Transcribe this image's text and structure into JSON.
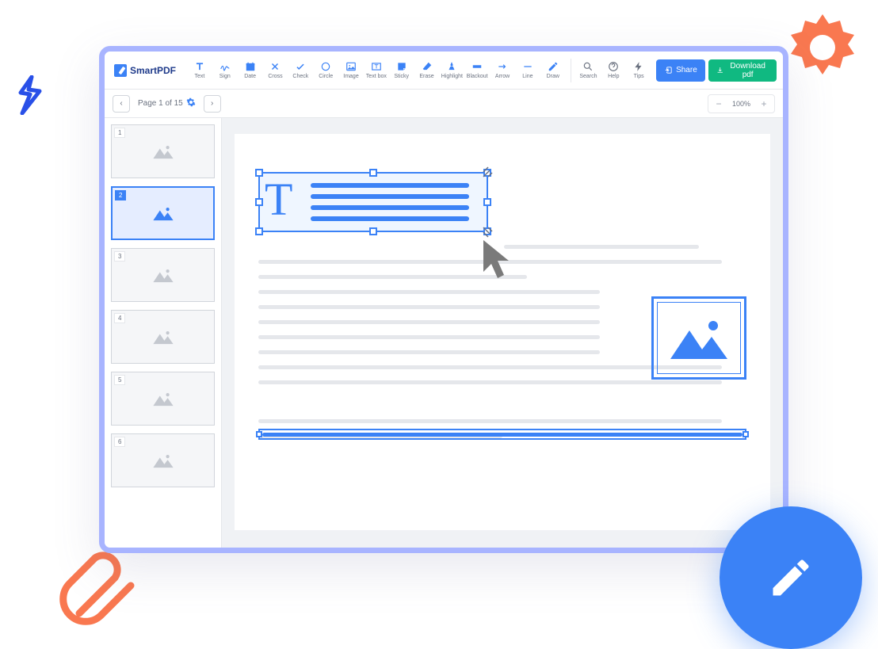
{
  "app": {
    "name": "SmartPDF"
  },
  "toolbar": {
    "tools": [
      {
        "id": "text",
        "label": "Text"
      },
      {
        "id": "sign",
        "label": "Sign"
      },
      {
        "id": "date",
        "label": "Date"
      },
      {
        "id": "cross",
        "label": "Cross"
      },
      {
        "id": "check",
        "label": "Check"
      },
      {
        "id": "circle",
        "label": "Circle"
      },
      {
        "id": "image",
        "label": "Image"
      },
      {
        "id": "textbox",
        "label": "Text box"
      },
      {
        "id": "sticky",
        "label": "Sticky"
      },
      {
        "id": "erase",
        "label": "Erase"
      },
      {
        "id": "highlight",
        "label": "Highlight"
      },
      {
        "id": "blackout",
        "label": "Blackout"
      },
      {
        "id": "arrow",
        "label": "Arrow"
      },
      {
        "id": "line",
        "label": "Line"
      },
      {
        "id": "draw",
        "label": "Draw"
      }
    ],
    "rightTools": [
      {
        "id": "search",
        "label": "Search"
      },
      {
        "id": "help",
        "label": "Help"
      },
      {
        "id": "tips",
        "label": "Tips"
      }
    ],
    "share": "Share",
    "download": "Download pdf"
  },
  "nav": {
    "pageInfo": "Page 1 of 15",
    "zoom": "100%"
  },
  "thumbnails": [
    {
      "num": "1",
      "active": false
    },
    {
      "num": "2",
      "active": true
    },
    {
      "num": "3",
      "active": false
    },
    {
      "num": "4",
      "active": false
    },
    {
      "num": "5",
      "active": false
    },
    {
      "num": "6",
      "active": false
    }
  ]
}
